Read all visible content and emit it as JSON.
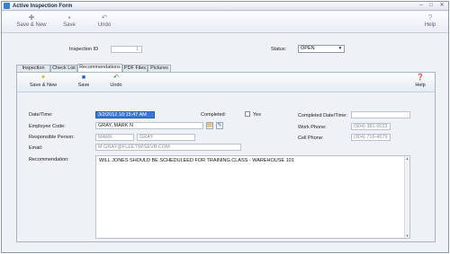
{
  "window": {
    "title": "Active Inspection Form",
    "min": "–",
    "max": "□",
    "close": "✕"
  },
  "toolbar": {
    "save_new": "Save & New",
    "save": "Save",
    "undo": "Undo",
    "help": "Help"
  },
  "header": {
    "inspection_id_label": "Inspection ID",
    "inspection_id_value": "1",
    "status_label": "Status:",
    "status_value": "OPEN"
  },
  "tabs": [
    "Inspection Info.",
    "Check List",
    "Recommendations",
    "PDF Files",
    "Pictures"
  ],
  "active_tab": "Recommendations",
  "subtoolbar": {
    "save_new": "Save & New",
    "save": "Save",
    "undo": "Undo",
    "help": "Help"
  },
  "form": {
    "datetime_label": "Date/Time:",
    "datetime_value": "3/2/2012 10:15:47 AM",
    "completed_label": "Completed:",
    "completed_yes": "Yes",
    "completed_datetime_label": "Completed Date/Time:",
    "completed_datetime_value": "",
    "employee_code_label": "Employee Code:",
    "employee_code_value": "GRAY, MARK N",
    "work_phone_label": "Work Phone:",
    "work_phone_value": "(904) 381-0023",
    "responsible_label": "Responsible Person:",
    "responsible_first": "MARK",
    "responsible_last": "GRAY",
    "cell_phone_label": "Cell Phone:",
    "cell_phone_value": "(904) 716-4579",
    "email_label": "Email:",
    "email_value": "M.GRAY@FLEETWISEVB.COM",
    "recommendation_label": "Recommendation:",
    "recommendation_value": "WILL JONES SHOULD BE SCHEDULEED FOR TRAINING.CLASS  - WAREHOUSE 101"
  }
}
